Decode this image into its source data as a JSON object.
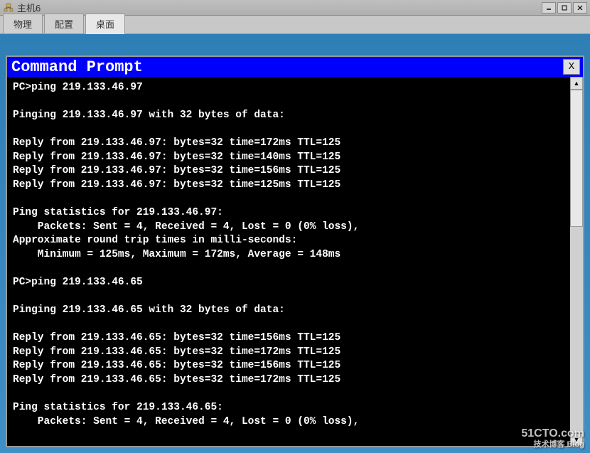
{
  "window": {
    "title": "主机6"
  },
  "tabs": {
    "physical": "物理",
    "config": "配置",
    "desktop": "桌面"
  },
  "cmd": {
    "title": "Command Prompt",
    "close": "X"
  },
  "terminal": {
    "lines": "PC>ping 219.133.46.97\n\nPinging 219.133.46.97 with 32 bytes of data:\n\nReply from 219.133.46.97: bytes=32 time=172ms TTL=125\nReply from 219.133.46.97: bytes=32 time=140ms TTL=125\nReply from 219.133.46.97: bytes=32 time=156ms TTL=125\nReply from 219.133.46.97: bytes=32 time=125ms TTL=125\n\nPing statistics for 219.133.46.97:\n    Packets: Sent = 4, Received = 4, Lost = 0 (0% loss),\nApproximate round trip times in milli-seconds:\n    Minimum = 125ms, Maximum = 172ms, Average = 148ms\n\nPC>ping 219.133.46.65\n\nPinging 219.133.46.65 with 32 bytes of data:\n\nReply from 219.133.46.65: bytes=32 time=156ms TTL=125\nReply from 219.133.46.65: bytes=32 time=172ms TTL=125\nReply from 219.133.46.65: bytes=32 time=156ms TTL=125\nReply from 219.133.46.65: bytes=32 time=172ms TTL=125\n\nPing statistics for 219.133.46.65:\n    Packets: Sent = 4, Received = 4, Lost = 0 (0% loss),"
  },
  "watermark": {
    "main": "51CTO.com",
    "sub": "技术博客  Blog"
  }
}
